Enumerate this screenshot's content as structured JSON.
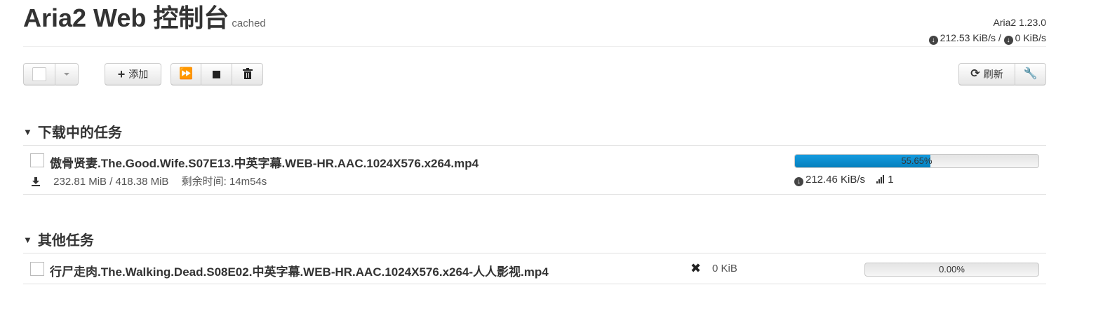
{
  "header": {
    "title": "Aria2 Web 控制台",
    "cached_label": "cached",
    "version": "Aria2 1.23.0",
    "download_speed": "212.53 KiB/s",
    "speed_separator": " / ",
    "upload_speed": "0 KiB/s"
  },
  "toolbar": {
    "add_label": "添加",
    "refresh_label": "刷新"
  },
  "sections": {
    "active": {
      "title": "下载中的任务",
      "tasks": [
        {
          "name": "傲骨贤妻.The.Good.Wife.S07E13.中英字幕.WEB-HR.AAC.1024X576.x264.mp4",
          "size": "232.81 MiB / 418.38 MiB",
          "remaining": "剩余时间: 14m54s",
          "speed": "212.46 KiB/s",
          "connections": "1",
          "progress_label": "55.65%",
          "progress": 55.65
        }
      ]
    },
    "other": {
      "title": "其他任务",
      "tasks": [
        {
          "name": "行尸走肉.The.Walking.Dead.S08E02.中英字幕.WEB-HR.AAC.1024X576.x264-人人影视.mp4",
          "size": "0 KiB",
          "progress_label": "0.00%",
          "progress": 0
        }
      ]
    }
  },
  "icons": {
    "speed": "arrow-circle-down-icon",
    "download": "download-icon",
    "signal": "signal-icon",
    "stopped": "x-icon",
    "accent_color": "#149bdf"
  }
}
